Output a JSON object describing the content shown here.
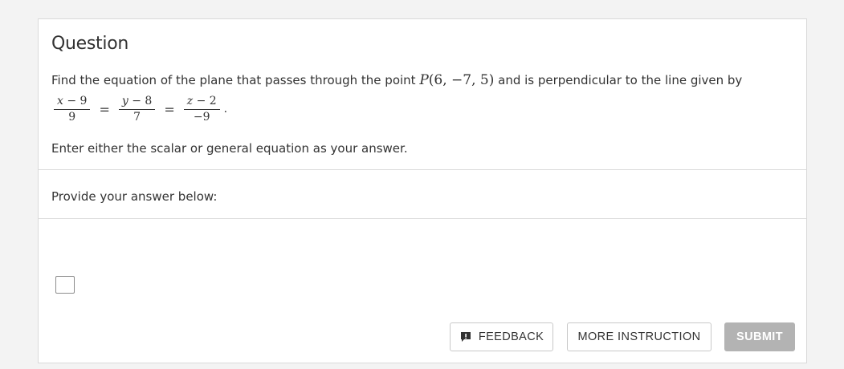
{
  "question": {
    "title": "Question",
    "text_before": "Find the equation of the plane that passes through the point ",
    "point_label": "P",
    "point_coords": "(6, −7, 5)",
    "text_after": " and is perpendicular to the line given by",
    "equation": {
      "frac1_num_var": "x",
      "frac1_num_rest": " − 9",
      "frac1_den": "9",
      "frac2_num_var": "y",
      "frac2_num_rest": " − 8",
      "frac2_den": "7",
      "frac3_num_var": "z",
      "frac3_num_rest": " − 2",
      "frac3_den": "−9",
      "equals": "=",
      "period": "."
    },
    "instruction": "Enter either the scalar or general equation as your answer."
  },
  "answer": {
    "label": "Provide your answer below:"
  },
  "buttons": {
    "feedback": "FEEDBACK",
    "more_instruction": "MORE INSTRUCTION",
    "submit": "SUBMIT"
  },
  "icons": {
    "feedback": "feedback-comment-icon"
  },
  "colors": {
    "submit_bg": "#b3b3b3",
    "border": "#d9d9d9",
    "text": "#333333"
  }
}
